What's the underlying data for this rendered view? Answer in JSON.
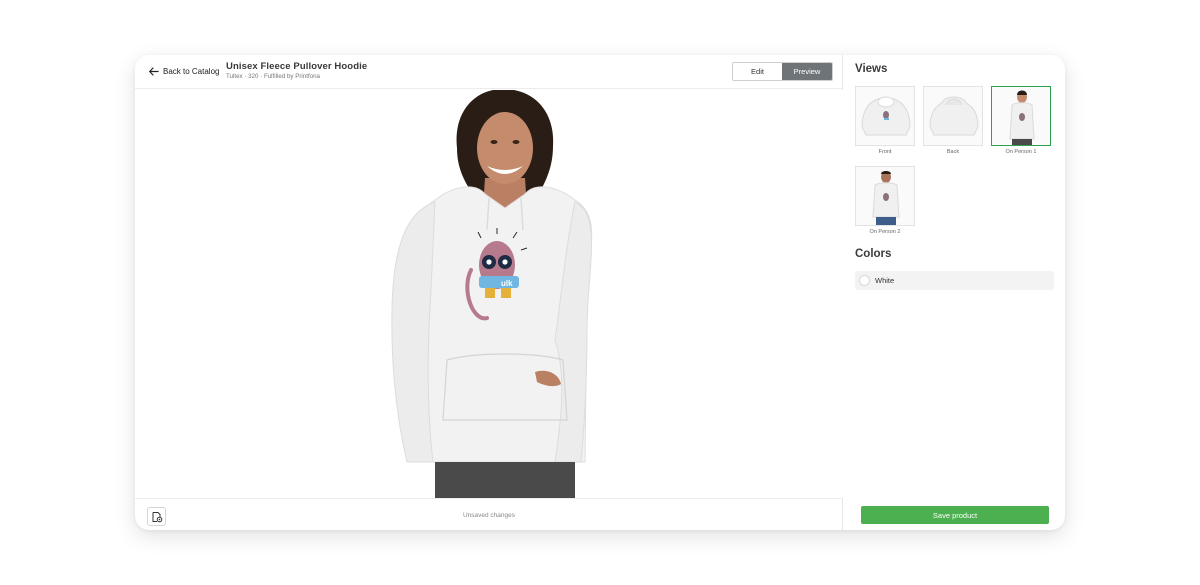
{
  "header": {
    "back_label": "Back to Catalog",
    "title": "Unisex Fleece Pullover Hoodie",
    "subtitle": "Tultex · 320 · Fulfilled by Printfona",
    "edit_label": "Edit",
    "preview_label": "Preview",
    "active_mode": "Preview"
  },
  "footer": {
    "status_text": "Unsaved changes",
    "icon": "layers-settings-icon"
  },
  "side": {
    "views_heading": "Views",
    "views": [
      {
        "label": "Front",
        "selected": false
      },
      {
        "label": "Back",
        "selected": false
      },
      {
        "label": "On Person 1",
        "selected": true
      },
      {
        "label": "On Person 2",
        "selected": false
      }
    ],
    "colors_heading": "Colors",
    "colors": [
      {
        "label": "White",
        "hex": "#ffffff"
      }
    ],
    "save_label": "Save product"
  },
  "colors": {
    "accent_green": "#4caf50",
    "selected_border": "#2aa14d",
    "toggle_active": "#6f7478"
  }
}
